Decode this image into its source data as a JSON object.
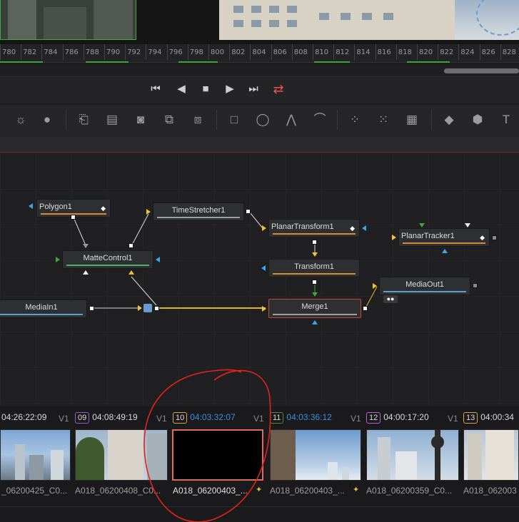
{
  "timeline": {
    "ruler_labels": [
      "780",
      "782",
      "784",
      "786",
      "788",
      "790",
      "792",
      "794",
      "796",
      "798",
      "800",
      "802",
      "804",
      "806",
      "808",
      "810",
      "812",
      "814",
      "816",
      "818",
      "820",
      "822",
      "824",
      "826",
      "828"
    ]
  },
  "transport": {
    "first_icon": "skip-to-start-icon",
    "prev_icon": "play-reverse-icon",
    "stop_icon": "stop-icon",
    "play_icon": "play-icon",
    "last_icon": "skip-to-end-icon",
    "loop_icon": "loop-icon",
    "loop_color": "#e4564b"
  },
  "toolbar": {
    "tools": [
      "brightness-contrast-icon",
      "color-corrector-icon",
      "loader-icon",
      "saver-icon",
      "matte-icon",
      "transform-icon",
      "merge-icon",
      "rectangle-mask-icon",
      "ellipse-mask-icon",
      "polygon-mask-icon",
      "bspline-mask-icon",
      "particle-emitter-icon",
      "particle-render-icon",
      "particle-image-icon",
      "shape3d-icon",
      "merge3d-icon",
      "text3d-icon"
    ]
  },
  "nodes": {
    "polygon": "Polygon1",
    "timestretcher": "TimeStretcher1",
    "planartransform": "PlanarTransform1",
    "plantracker": "PlanarTracker1",
    "mattecontrol": "MatteControl1",
    "transform": "Transform1",
    "mediaout": "MediaOut1",
    "mediain": "MediaIn1",
    "merge": "Merge1"
  },
  "colors": {
    "mask_bar": "#d88a3a",
    "tool_bar": "#9aa0a6",
    "matte_bar": "#4caf6a",
    "io_bar": "#5aa0d8",
    "selected_border": "#c4473c",
    "connection": "#e6b22e"
  },
  "clips": [
    {
      "num": "",
      "tc": "04:26:22:09",
      "track": "V1",
      "name": "_06200425_C0...",
      "num_color": "#888888",
      "tc_color": "#d8d8d8"
    },
    {
      "num": "09",
      "tc": "04:08:49:19",
      "track": "V1",
      "name": "A018_06200408_C0...",
      "num_color": "#9b59d0",
      "tc_color": "#d8d8d8"
    },
    {
      "num": "10",
      "tc": "04:03:32:07",
      "track": "V1",
      "name": "A018_06200403_...",
      "num_color": "#d6a73a",
      "tc_color": "#3a8ee0"
    },
    {
      "num": "11",
      "tc": "04:03:36:12",
      "track": "V1",
      "name": "A018_06200403_...",
      "num_color": "#4a8a3a",
      "tc_color": "#3a8ee0"
    },
    {
      "num": "12",
      "tc": "04:00:17:20",
      "track": "V1",
      "name": "A018_06200359_C0...",
      "num_color": "#c45ad8",
      "tc_color": "#d8d8d8"
    },
    {
      "num": "13",
      "tc": "04:00:34",
      "track": "",
      "name": "A018_062003",
      "num_color": "#e0a23a",
      "tc_color": "#d8d8d8"
    }
  ]
}
